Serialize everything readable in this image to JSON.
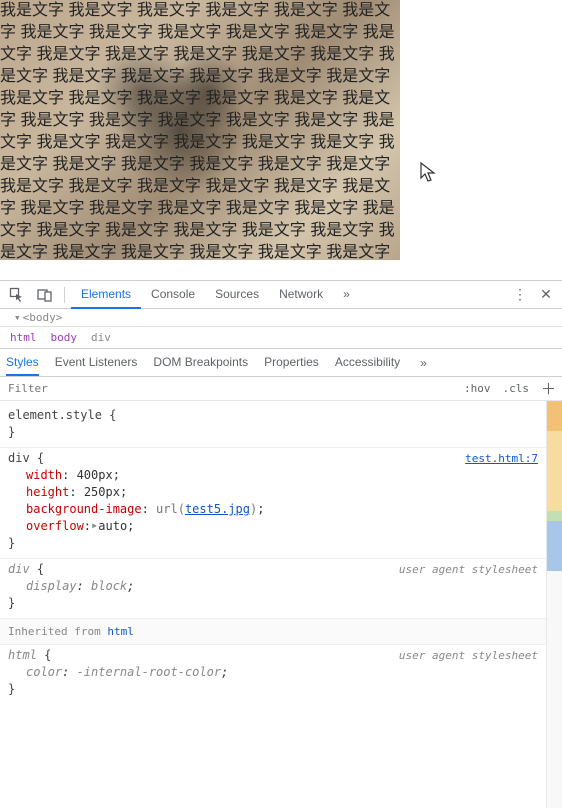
{
  "preview": {
    "repeated_word": "我是文字",
    "repeat_count": 80
  },
  "devtools": {
    "main_tabs": [
      "Elements",
      "Console",
      "Sources",
      "Network"
    ],
    "active_main_tab": "Elements",
    "dom_mini": "<body>",
    "breadcrumb": [
      "html",
      "body",
      "div"
    ],
    "sub_tabs": [
      "Styles",
      "Event Listeners",
      "DOM Breakpoints",
      "Properties",
      "Accessibility"
    ],
    "active_sub_tab": "Styles",
    "filter_placeholder": "Filter",
    "filter_btns": {
      "hov": ":hov",
      "cls": ".cls"
    }
  },
  "styles": {
    "rules": [
      {
        "id": "element-style",
        "selector": "element.style",
        "origin_type": "inline",
        "decls": []
      },
      {
        "id": "div-rule",
        "selector": "div",
        "origin_type": "file",
        "origin_label": "test.html:7",
        "decls": [
          {
            "prop": "width",
            "val": "400px"
          },
          {
            "prop": "height",
            "val": "250px"
          },
          {
            "prop": "background-image",
            "val_type": "url",
            "url_text": "test5.jpg"
          },
          {
            "prop": "overflow",
            "val_type": "expander",
            "val": "auto"
          }
        ]
      },
      {
        "id": "div-ua",
        "selector": "div",
        "origin_type": "ua",
        "origin_label": "user agent stylesheet",
        "italic": true,
        "decls": [
          {
            "prop": "display",
            "val": "block",
            "italic": true
          }
        ]
      }
    ],
    "inherited_label": "Inherited from",
    "inherited_from": "html",
    "inherited_rule": {
      "id": "html-ua",
      "selector": "html",
      "origin_type": "ua",
      "origin_label": "user agent stylesheet",
      "italic": true,
      "decls": [
        {
          "prop": "color",
          "val": "-internal-root-color",
          "italic": true
        }
      ]
    }
  }
}
